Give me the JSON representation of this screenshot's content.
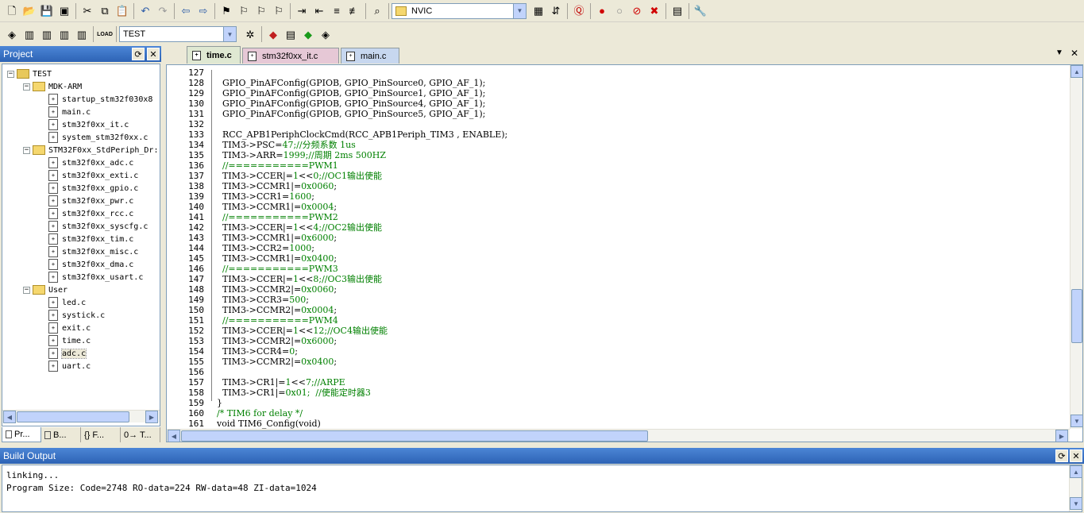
{
  "toolbar1": {
    "icons": [
      "new-file-icon",
      "open-folder-icon",
      "save-icon",
      "save-all-icon",
      "cut-icon",
      "copy-icon",
      "paste-icon",
      "undo-icon",
      "redo-icon",
      "nav-back-icon",
      "nav-forward-icon",
      "bookmark-icon",
      "prev-bookmark-icon",
      "next-bookmark-icon",
      "clear-bookmarks-icon",
      "indent-icon",
      "unindent-icon",
      "comment-icon",
      "uncomment-icon",
      "find-in-files-icon"
    ],
    "find_combo_value": "NVIC",
    "debug_icons": [
      "find-icon",
      "incremental-find-icon",
      "start-debug-icon",
      "breakpoint-icon",
      "disable-breakpoint-icon",
      "kill-breakpoints-icon",
      "clear-breakpoints-icon",
      "window-config-icon",
      "settings-wrench-icon"
    ]
  },
  "toolbar2": {
    "icons": [
      "translate-icon",
      "build-icon",
      "rebuild-icon",
      "batch-build-icon",
      "stop-build-icon",
      "load-icon"
    ],
    "load_label": "LOAD",
    "target_combo_value": "TEST",
    "after_icons": [
      "target-options-icon",
      "manage-components-icon",
      "file-extensions-icon",
      "run-icon",
      "pack-installer-icon"
    ]
  },
  "project_panel": {
    "title": "Project",
    "tree": [
      {
        "level": 0,
        "type": "root",
        "label": "TEST",
        "toggle": "−"
      },
      {
        "level": 1,
        "type": "folder",
        "label": "MDK-ARM",
        "toggle": "−"
      },
      {
        "level": 2,
        "type": "file",
        "label": "startup_stm32f030x8"
      },
      {
        "level": 2,
        "type": "file",
        "label": "main.c"
      },
      {
        "level": 2,
        "type": "file",
        "label": "stm32f0xx_it.c"
      },
      {
        "level": 2,
        "type": "file",
        "label": "system_stm32f0xx.c"
      },
      {
        "level": 1,
        "type": "folder",
        "label": "STM32F0xx_StdPeriph_Dr:",
        "toggle": "−"
      },
      {
        "level": 2,
        "type": "file",
        "label": "stm32f0xx_adc.c"
      },
      {
        "level": 2,
        "type": "file",
        "label": "stm32f0xx_exti.c"
      },
      {
        "level": 2,
        "type": "file",
        "label": "stm32f0xx_gpio.c"
      },
      {
        "level": 2,
        "type": "file",
        "label": "stm32f0xx_pwr.c"
      },
      {
        "level": 2,
        "type": "file",
        "label": "stm32f0xx_rcc.c"
      },
      {
        "level": 2,
        "type": "file",
        "label": "stm32f0xx_syscfg.c"
      },
      {
        "level": 2,
        "type": "file",
        "label": "stm32f0xx_tim.c"
      },
      {
        "level": 2,
        "type": "file",
        "label": "stm32f0xx_misc.c"
      },
      {
        "level": 2,
        "type": "file",
        "label": "stm32f0xx_dma.c"
      },
      {
        "level": 2,
        "type": "file",
        "label": "stm32f0xx_usart.c"
      },
      {
        "level": 1,
        "type": "folder",
        "label": "User",
        "toggle": "−"
      },
      {
        "level": 2,
        "type": "file",
        "label": "led.c"
      },
      {
        "level": 2,
        "type": "file",
        "label": "systick.c"
      },
      {
        "level": 2,
        "type": "file",
        "label": "exit.c"
      },
      {
        "level": 2,
        "type": "file",
        "label": "time.c"
      },
      {
        "level": 2,
        "type": "file",
        "label": "adc.c",
        "selected": true
      },
      {
        "level": 2,
        "type": "file",
        "label": "uart.c"
      }
    ],
    "tabs": [
      {
        "label": "Pr...",
        "icon": "project-tab-icon"
      },
      {
        "label": "B...",
        "icon": "books-tab-icon"
      },
      {
        "label": "{} F...",
        "icon": "functions-tab-icon"
      },
      {
        "label": "0→ T...",
        "icon": "templates-tab-icon"
      }
    ]
  },
  "editor": {
    "tabs": [
      {
        "label": "time.c",
        "active": true,
        "color": "#dfe8d2"
      },
      {
        "label": "stm32f0xx_it.c",
        "active": false,
        "color": "#e6c8d6"
      },
      {
        "label": "main.c",
        "active": false,
        "color": "#c7d7ef"
      }
    ],
    "lines": [
      {
        "n": "127",
        "segs": [
          {
            "t": "",
            "c": ""
          }
        ]
      },
      {
        "n": "128",
        "segs": [
          {
            "t": "  GPIO_PinAFConfig(GPIOB, GPIO_PinSource0, GPIO_AF_1);",
            "c": ""
          }
        ]
      },
      {
        "n": "129",
        "segs": [
          {
            "t": "  GPIO_PinAFConfig(GPIOB, GPIO_PinSource1, GPIO_AF_1);",
            "c": ""
          }
        ]
      },
      {
        "n": "130",
        "segs": [
          {
            "t": "  GPIO_PinAFConfig(GPIOB, GPIO_PinSource4, GPIO_AF_1);",
            "c": ""
          }
        ]
      },
      {
        "n": "131",
        "segs": [
          {
            "t": "  GPIO_PinAFConfig(GPIOB, GPIO_PinSource5, GPIO_AF_1);",
            "c": ""
          }
        ]
      },
      {
        "n": "132",
        "segs": [
          {
            "t": "",
            "c": ""
          }
        ]
      },
      {
        "n": "133",
        "segs": [
          {
            "t": "  RCC_APB1PeriphClockCmd(RCC_APB1Periph_TIM3 , ENABLE);",
            "c": ""
          }
        ]
      },
      {
        "n": "134",
        "segs": [
          {
            "t": "  TIM3->PSC=",
            "c": ""
          },
          {
            "t": "47",
            "c": "nm"
          },
          {
            "t": ";//分频系数 1us",
            "c": "cm"
          }
        ]
      },
      {
        "n": "135",
        "segs": [
          {
            "t": "  TIM3->ARR=",
            "c": ""
          },
          {
            "t": "1999",
            "c": "nm"
          },
          {
            "t": ";//周期 2ms 500HZ",
            "c": "cm"
          }
        ]
      },
      {
        "n": "136",
        "segs": [
          {
            "t": "  //===========PWM1",
            "c": "cm"
          }
        ]
      },
      {
        "n": "137",
        "segs": [
          {
            "t": "  TIM3->CCER|=",
            "c": ""
          },
          {
            "t": "1",
            "c": "nm"
          },
          {
            "t": "<<",
            "c": ""
          },
          {
            "t": "0",
            "c": "nm"
          },
          {
            "t": ";//OC1输出使能",
            "c": "cm"
          }
        ]
      },
      {
        "n": "138",
        "segs": [
          {
            "t": "  TIM3->CCMR1|=",
            "c": ""
          },
          {
            "t": "0x0060",
            "c": "nm"
          },
          {
            "t": ";",
            "c": ""
          }
        ]
      },
      {
        "n": "139",
        "segs": [
          {
            "t": "  TIM3->CCR1=",
            "c": ""
          },
          {
            "t": "1600",
            "c": "nm"
          },
          {
            "t": ";",
            "c": ""
          }
        ]
      },
      {
        "n": "140",
        "segs": [
          {
            "t": "  TIM3->CCMR1|=",
            "c": ""
          },
          {
            "t": "0x0004",
            "c": "nm"
          },
          {
            "t": ";",
            "c": ""
          }
        ]
      },
      {
        "n": "141",
        "segs": [
          {
            "t": "  //===========PWM2",
            "c": "cm"
          }
        ]
      },
      {
        "n": "142",
        "segs": [
          {
            "t": "  TIM3->CCER|=",
            "c": ""
          },
          {
            "t": "1",
            "c": "nm"
          },
          {
            "t": "<<",
            "c": ""
          },
          {
            "t": "4",
            "c": "nm"
          },
          {
            "t": ";//OC2输出使能",
            "c": "cm"
          }
        ]
      },
      {
        "n": "143",
        "segs": [
          {
            "t": "  TIM3->CCMR1|=",
            "c": ""
          },
          {
            "t": "0x6000",
            "c": "nm"
          },
          {
            "t": ";",
            "c": ""
          }
        ]
      },
      {
        "n": "144",
        "segs": [
          {
            "t": "  TIM3->CCR2=",
            "c": ""
          },
          {
            "t": "1000",
            "c": "nm"
          },
          {
            "t": ";",
            "c": ""
          }
        ]
      },
      {
        "n": "145",
        "segs": [
          {
            "t": "  TIM3->CCMR1|=",
            "c": ""
          },
          {
            "t": "0x0400",
            "c": "nm"
          },
          {
            "t": ";",
            "c": ""
          }
        ]
      },
      {
        "n": "146",
        "segs": [
          {
            "t": "  //===========PWM3",
            "c": "cm"
          }
        ]
      },
      {
        "n": "147",
        "segs": [
          {
            "t": "  TIM3->CCER|=",
            "c": ""
          },
          {
            "t": "1",
            "c": "nm"
          },
          {
            "t": "<<",
            "c": ""
          },
          {
            "t": "8",
            "c": "nm"
          },
          {
            "t": ";//OC3输出使能",
            "c": "cm"
          }
        ]
      },
      {
        "n": "148",
        "segs": [
          {
            "t": "  TIM3->CCMR2|=",
            "c": ""
          },
          {
            "t": "0x0060",
            "c": "nm"
          },
          {
            "t": ";",
            "c": ""
          }
        ]
      },
      {
        "n": "149",
        "segs": [
          {
            "t": "  TIM3->CCR3=",
            "c": ""
          },
          {
            "t": "500",
            "c": "nm"
          },
          {
            "t": ";",
            "c": ""
          }
        ]
      },
      {
        "n": "150",
        "segs": [
          {
            "t": "  TIM3->CCMR2|=",
            "c": ""
          },
          {
            "t": "0x0004",
            "c": "nm"
          },
          {
            "t": ";",
            "c": ""
          }
        ]
      },
      {
        "n": "151",
        "segs": [
          {
            "t": "  //===========PWM4",
            "c": "cm"
          }
        ]
      },
      {
        "n": "152",
        "segs": [
          {
            "t": "  TIM3->CCER|=",
            "c": ""
          },
          {
            "t": "1",
            "c": "nm"
          },
          {
            "t": "<<",
            "c": ""
          },
          {
            "t": "12",
            "c": "nm"
          },
          {
            "t": ";//OC4输出使能",
            "c": "cm"
          }
        ]
      },
      {
        "n": "153",
        "segs": [
          {
            "t": "  TIM3->CCMR2|=",
            "c": ""
          },
          {
            "t": "0x6000",
            "c": "nm"
          },
          {
            "t": ";",
            "c": ""
          }
        ]
      },
      {
        "n": "154",
        "segs": [
          {
            "t": "  TIM3->CCR4=",
            "c": ""
          },
          {
            "t": "0",
            "c": "nm"
          },
          {
            "t": ";",
            "c": ""
          }
        ]
      },
      {
        "n": "155",
        "segs": [
          {
            "t": "  TIM3->CCMR2|=",
            "c": ""
          },
          {
            "t": "0x0400",
            "c": "nm"
          },
          {
            "t": ";",
            "c": ""
          }
        ]
      },
      {
        "n": "156",
        "segs": [
          {
            "t": "",
            "c": ""
          }
        ]
      },
      {
        "n": "157",
        "segs": [
          {
            "t": "  TIM3->CR1|=",
            "c": ""
          },
          {
            "t": "1",
            "c": "nm"
          },
          {
            "t": "<<",
            "c": ""
          },
          {
            "t": "7",
            "c": "nm"
          },
          {
            "t": ";//ARPE",
            "c": "cm"
          }
        ]
      },
      {
        "n": "158",
        "segs": [
          {
            "t": "  TIM3->CR1|=",
            "c": ""
          },
          {
            "t": "0x01",
            "c": "nm"
          },
          {
            "t": ";  //使能定时器3",
            "c": "cm"
          }
        ]
      },
      {
        "n": "159",
        "segs": [
          {
            "t": "}",
            "c": ""
          }
        ]
      },
      {
        "n": "160",
        "segs": [
          {
            "t": "/* TIM6 for delay */",
            "c": "cm"
          }
        ]
      },
      {
        "n": "161",
        "segs": [
          {
            "t": "void TIM6_Config(void)",
            "c": ""
          }
        ]
      }
    ]
  },
  "build_output": {
    "title": "Build Output",
    "lines": [
      "linking...",
      "Program Size: Code=2748 RO-data=224 RW-data=48 ZI-data=1024"
    ]
  },
  "colors": {
    "panel_title": "#3a72c8",
    "comment": "#008000",
    "accent_scroll": "#c1d3fb"
  }
}
